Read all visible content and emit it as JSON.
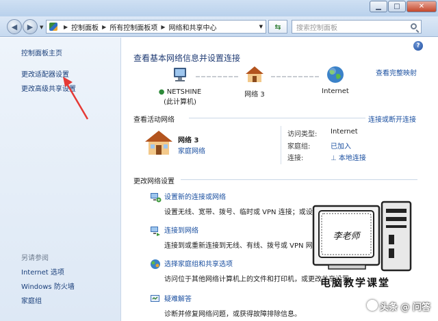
{
  "window": {
    "min_label": "▁",
    "max_label": "□",
    "close_label": "✕"
  },
  "address": {
    "crumbs": [
      "控制面板",
      "所有控制面板项",
      "网络和共享中心"
    ],
    "search_placeholder": "搜索控制面板"
  },
  "sidebar": {
    "home": "控制面板主页",
    "adapter": "更改适配器设置",
    "sharing": "更改高级共享设置",
    "see_also": "另请参阅",
    "links": [
      "Internet 选项",
      "Windows 防火墙",
      "家庭组"
    ]
  },
  "main": {
    "title": "查看基本网络信息并设置连接",
    "see_full_map": "查看完整映射",
    "map": {
      "computer_name": "NETSHINE",
      "computer_sub": "(此计算机)",
      "network_name": "网络  3",
      "internet": "Internet"
    },
    "active": {
      "header": "查看活动网络",
      "connect_link": "连接或断开连接",
      "name": "网络  3",
      "type": "家庭网络",
      "rows": [
        {
          "k": "访问类型:",
          "v": "Internet",
          "link": false
        },
        {
          "k": "家庭组:",
          "v": "已加入",
          "link": true
        },
        {
          "k": "连接:",
          "v": "本地连接",
          "link": true
        }
      ]
    },
    "change_header": "更改网络设置",
    "tasks": [
      {
        "title": "设置新的连接或网络",
        "desc": "设置无线、宽带、拨号、临时或 VPN 连接；或设置路由器或访问点。"
      },
      {
        "title": "连接到网络",
        "desc": "连接到或重新连接到无线、有线、拨号或 VPN 网络连接。"
      },
      {
        "title": "选择家庭组和共享选项",
        "desc": "访问位于其他网络计算机上的文件和打印机，或更改共享设置。"
      },
      {
        "title": "疑难解答",
        "desc": "诊断并修复网络问题，或获得故障排除信息。"
      }
    ]
  },
  "watermark": {
    "screen_text": "李老师",
    "title": "电脑教学课堂",
    "brand": "头条 @ 问答"
  },
  "colors": {
    "link": "#1a4fa0",
    "title": "#1e3a73",
    "sidebar_bg": "#dde8f5",
    "arrow": "#e53935"
  }
}
